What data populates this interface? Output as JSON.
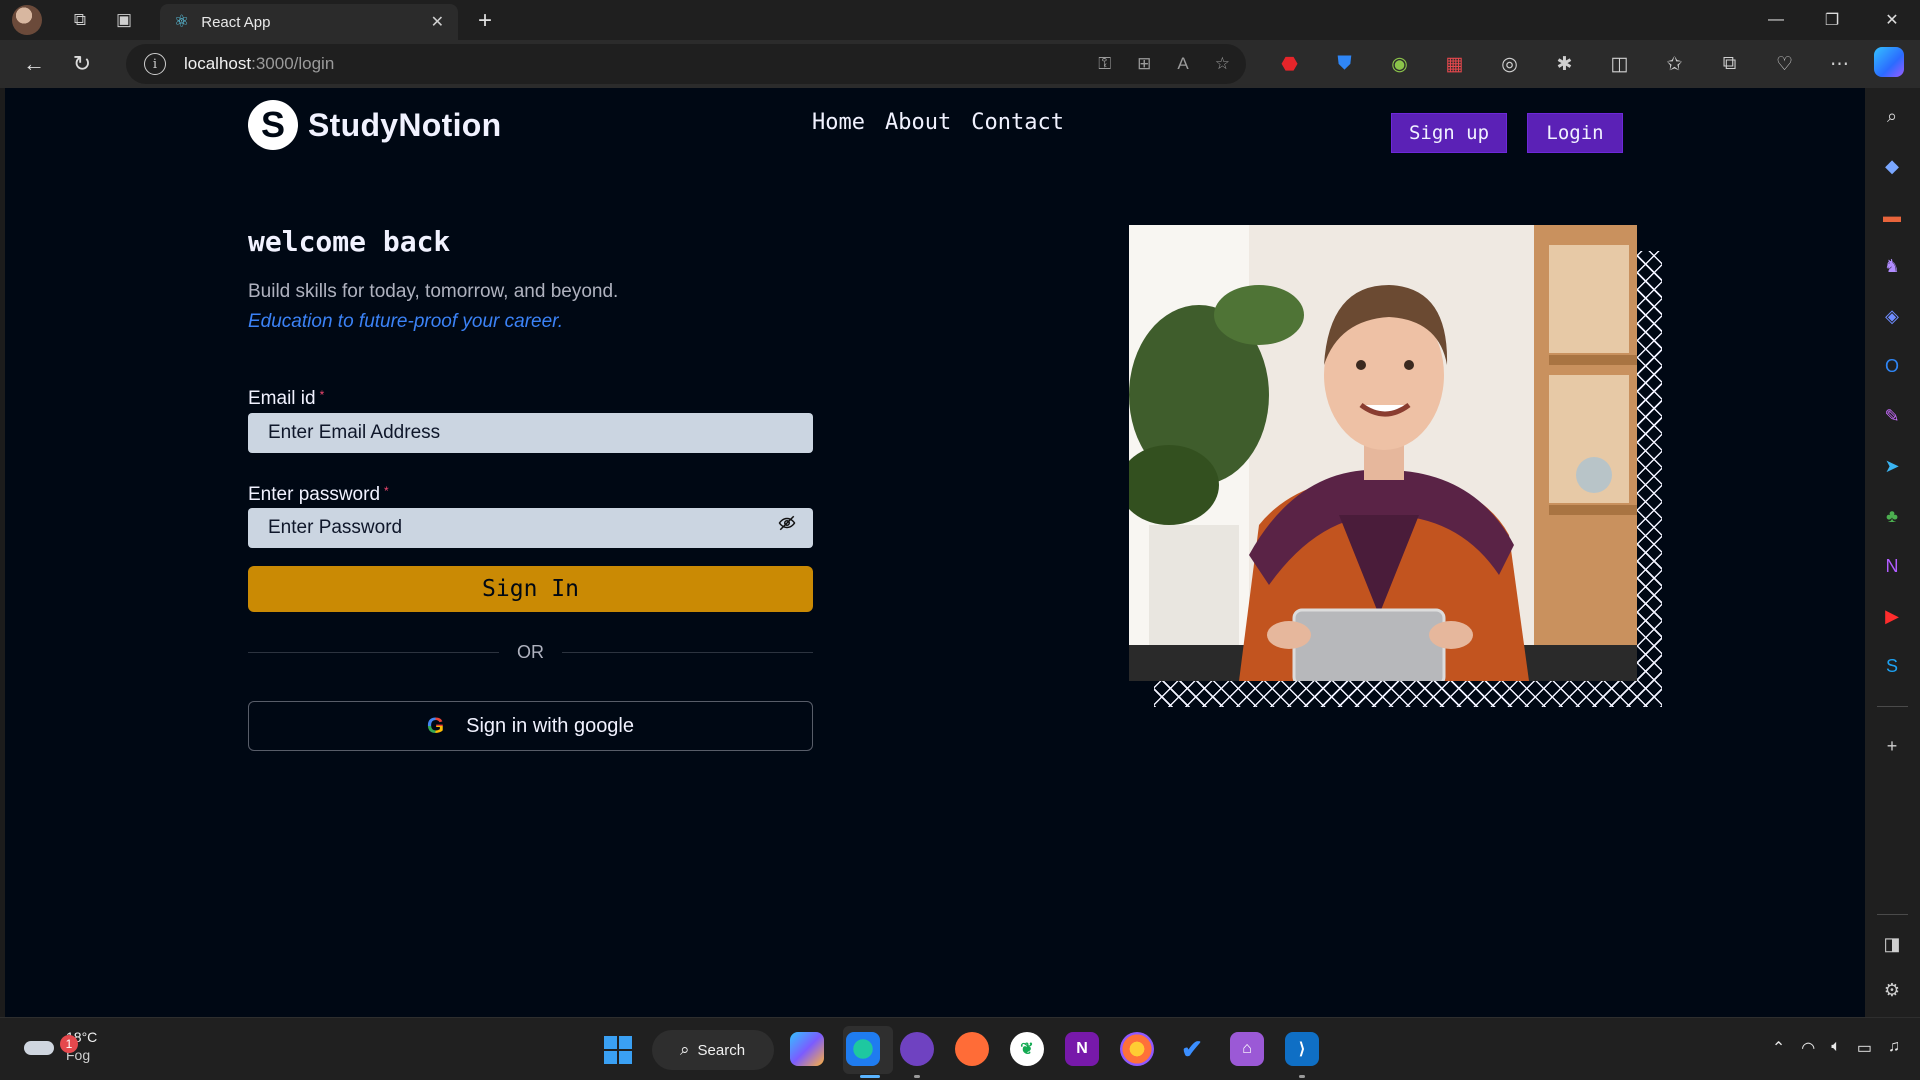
{
  "browser": {
    "tab_title": "React App",
    "tab_close": "✕",
    "new_tab": "+",
    "url_host": "localhost",
    "url_rest": ":3000/login",
    "info_glyph": "i",
    "window_controls": [
      "—",
      "❐",
      "✕"
    ]
  },
  "site": {
    "logo_mark": "S",
    "logo_text": "StudyNotion",
    "nav_links": [
      "Home",
      "About",
      "Contact"
    ],
    "signup_label": "Sign up",
    "login_label": "Login"
  },
  "login": {
    "heading": "welcome back",
    "subtitle": "Build skills for today, tomorrow, and beyond.",
    "subtitle_emphasis": "Education to future-proof your career.",
    "email_label": "Email id",
    "email_placeholder": "Enter Email Address",
    "password_label": "Enter password",
    "password_placeholder": "Enter Password",
    "required_mark": "*",
    "signin_label": "Sign In",
    "or_text": "OR",
    "google_mark": "G",
    "google_label": "Sign in with google"
  },
  "taskbar": {
    "weather_temp": "18°C",
    "weather_desc": "Fog",
    "weather_badge": "1",
    "search_label": "Search"
  },
  "colors": {
    "page_bg": "#000814",
    "accent_yellow": "#ca8a04",
    "accent_purple": "#5b21b6",
    "link_blue": "#3b82f6"
  }
}
